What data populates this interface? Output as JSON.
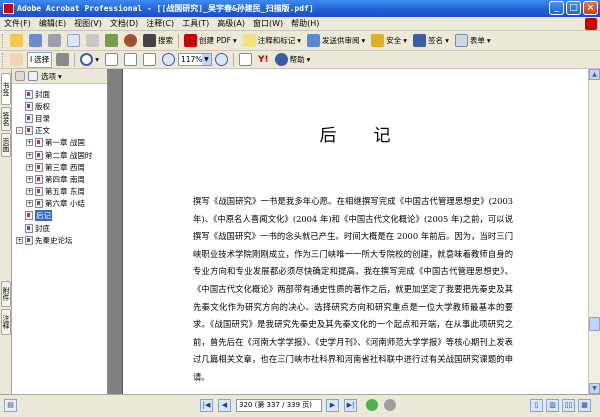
{
  "window": {
    "title": "Adobe Acrobat Professional - [[战国研究]_吴宇春&孙建民_扫描版.pdf]",
    "buttons": [
      "_",
      "□",
      "×"
    ]
  },
  "menu": [
    "文件(F)",
    "编辑(E)",
    "视图(V)",
    "文档(D)",
    "注释(C)",
    "工具(T)",
    "高级(A)",
    "窗口(W)",
    "帮助(H)"
  ],
  "toolbar1": {
    "search_label": "搜索",
    "create_pdf_label": "创建 PDF",
    "comment_label": "注释和标记",
    "send_review_label": "发送供审阅",
    "secure_label": "安全",
    "sign_label": "签名",
    "form_label": "表单"
  },
  "toolbar2": {
    "select_label": "选择",
    "zoom_value": "117%",
    "help_label": "帮助"
  },
  "left_tabs": [
    "书签",
    "签名",
    "页面",
    "附件",
    "注释"
  ],
  "bookmarks": {
    "options_label": "选项",
    "items": [
      {
        "label": "封面",
        "level": 1,
        "expander": ""
      },
      {
        "label": "版权",
        "level": 1,
        "expander": ""
      },
      {
        "label": "目录",
        "level": 1,
        "expander": ""
      },
      {
        "label": "正文",
        "level": 1,
        "expander": "-"
      },
      {
        "label": "第一章 战国",
        "level": 2,
        "expander": "+"
      },
      {
        "label": "第二章 战国时",
        "level": 2,
        "expander": "+"
      },
      {
        "label": "第三章 西周",
        "level": 2,
        "expander": "+"
      },
      {
        "label": "第四章 南周",
        "level": 2,
        "expander": "+"
      },
      {
        "label": "第五章 东周",
        "level": 2,
        "expander": "+"
      },
      {
        "label": "第六章 小结",
        "level": 2,
        "expander": "+"
      },
      {
        "label": "后记",
        "level": 1,
        "expander": "",
        "selected": true
      },
      {
        "label": "封底",
        "level": 1,
        "expander": ""
      },
      {
        "label": "先秦史论坛",
        "level": 1,
        "expander": "+"
      }
    ]
  },
  "page": {
    "heading": "后　　记",
    "paragraph": "撰写《战国研究》一书是我多年心愿。在相继撰写完成《中国古代管理思想史》(2003 年)、《中原名人喜闻文化》(2004 年)和《中国古代文化概论》(2005 年)之前，可以说撰写《战国研究》一书的念头就已产生。时间大概是在 2000 年前后。因为，当时三门峡职业技术学院刚刚成立，作为三门峡唯一一所大专院校的创建，就意味着教师自身的专业方向和专业发展都必须尽快确定和提高。我在撰写完成《中国古代管理思想史》、《中国古代文化概论》两部带有通史性质的著作之后，就更加坚定了我要把先秦史及其先秦文化作为研究方向的决心。选择研究方向和研究重点是一位大学教师最基本的要求。《战国研究》是我研究先秦史及其先秦文化的一个起点和开端，在从事此项研究之前，曾先后在《河南大学学报》、《史学月刊》、《河南师范大学学报》等核心期刊上发表过几篇相关文章，也在三门峡市社科界和河南省社科联中进行过有关战国研究课题的申请。"
  },
  "nav": {
    "page_display": "320 (第 337 / 339 页)"
  },
  "colors": {
    "titlebar": "#1f5fd6",
    "selected": "#316ac5",
    "doc_background": "#808080"
  }
}
